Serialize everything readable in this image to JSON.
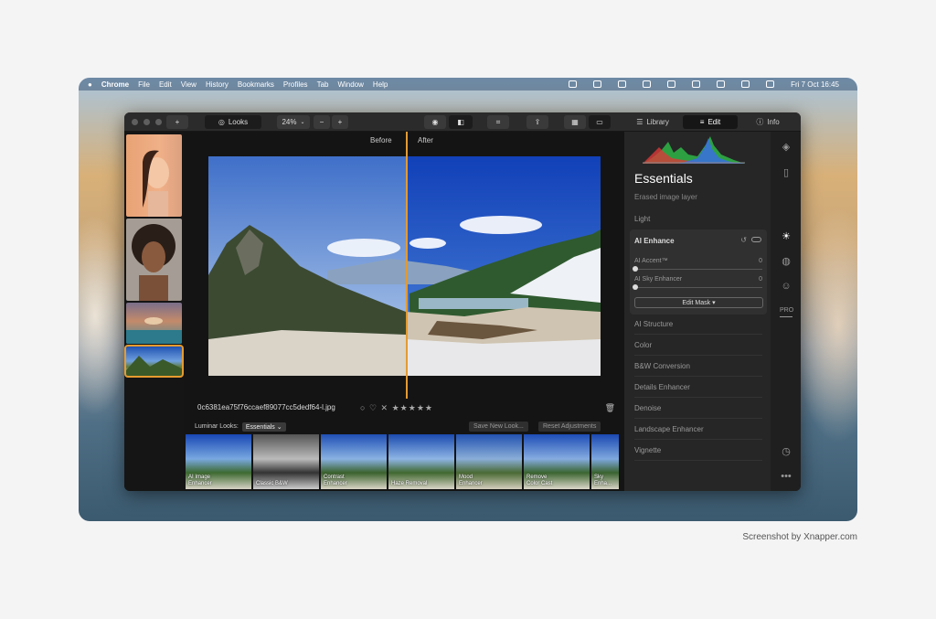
{
  "menubar": {
    "app": "Chrome",
    "items": [
      "File",
      "Edit",
      "View",
      "History",
      "Bookmarks",
      "Profiles",
      "Tab",
      "Window",
      "Help"
    ],
    "clock": "Fri 7 Oct  16:45"
  },
  "toolbar": {
    "looks_label": "Looks",
    "zoom": "24%",
    "tabs": {
      "library": "Library",
      "edit": "Edit",
      "info": "Info"
    }
  },
  "viewer": {
    "before": "Before",
    "after": "After",
    "filename": "0c6381ea75f76ccaef89077cc5dedf64-l.jpg",
    "stars": "★★★★★"
  },
  "looks": {
    "label": "Luminar Looks:",
    "selected": "Essentials",
    "save": "Save New Look...",
    "reset": "Reset Adjustments",
    "items": [
      "AI Image\nEnhancer",
      "Classic B&W",
      "Contrast\nEnhancer",
      "Haze Removal",
      "Mood\nEnhancer",
      "Remove\nColor Cast",
      "Sky Enha..."
    ]
  },
  "panel": {
    "title": "Essentials",
    "subtitle": "Erased image layer",
    "light": "Light",
    "ai_enhance": {
      "title": "AI Enhance",
      "accent_label": "AI Accent™",
      "accent_value": "0",
      "sky_label": "AI Sky Enhancer",
      "sky_value": "0",
      "mask_button": "Edit Mask ▾"
    },
    "sections": [
      "AI Structure",
      "Color",
      "B&W Conversion",
      "Details Enhancer",
      "Denoise",
      "Landscape Enhancer",
      "Vignette"
    ]
  },
  "sidebar": {
    "pro_label": "PRO"
  },
  "credit": "Screenshot by Xnapper.com"
}
